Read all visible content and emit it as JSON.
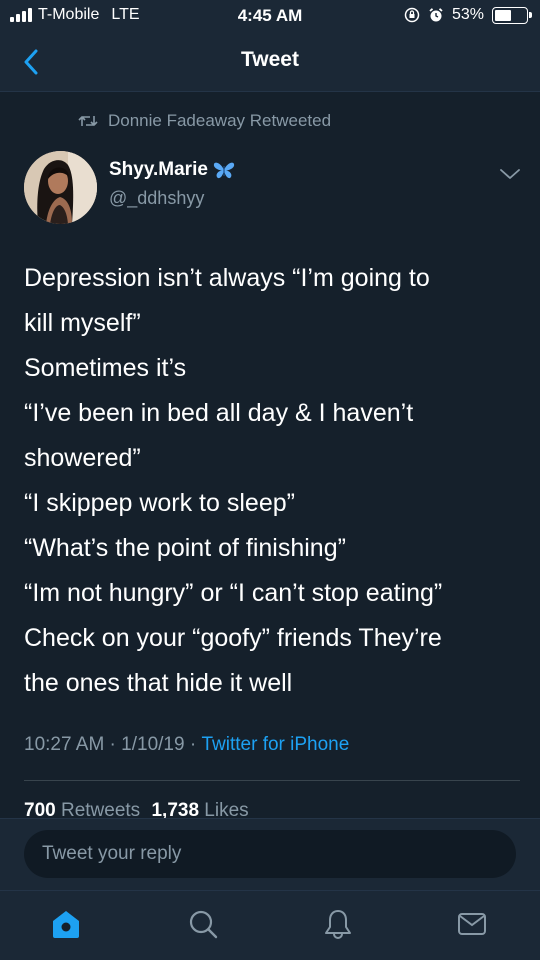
{
  "status_bar": {
    "carrier": "T-Mobile",
    "network": "LTE",
    "time": "4:45 AM",
    "battery": "53%",
    "battery_level": 0.53
  },
  "nav": {
    "back_icon": "chevron-left-icon",
    "title": "Tweet"
  },
  "tweet": {
    "retweet_label": "Donnie Fadeaway Retweeted",
    "author": {
      "name": "Shyy.Marie",
      "handle": "@_ddhshyy"
    },
    "lines": [
      "Depression isn’t always “I’m going to",
      "kill myself”",
      "Sometimes it’s",
      "“I’ve been in bed all day & I haven’t",
      "showered”",
      "“I skippep work to sleep”",
      "“What’s the point of finishing”",
      "“Im not hungry” or “I can’t stop eating”",
      "Check on your “goofy” friends They’re",
      "the ones that hide it well"
    ],
    "time": "10:27 AM",
    "date": "1/10/19",
    "separator": " · ",
    "source": "Twitter for iPhone",
    "retweets_count": "700",
    "retweets_label": "Retweets",
    "likes_count": "1,738",
    "likes_label": "Likes"
  },
  "reply": {
    "placeholder": "Tweet your reply"
  },
  "tabs": [
    {
      "name": "home-icon",
      "active": true
    },
    {
      "name": "search-icon",
      "active": false
    },
    {
      "name": "notifications-icon",
      "active": false
    },
    {
      "name": "messages-icon",
      "active": false
    }
  ],
  "colors": {
    "background": "#15202b",
    "bar": "#1b2836",
    "secondary_text": "#8899a6",
    "accent": "#1da1f2"
  }
}
